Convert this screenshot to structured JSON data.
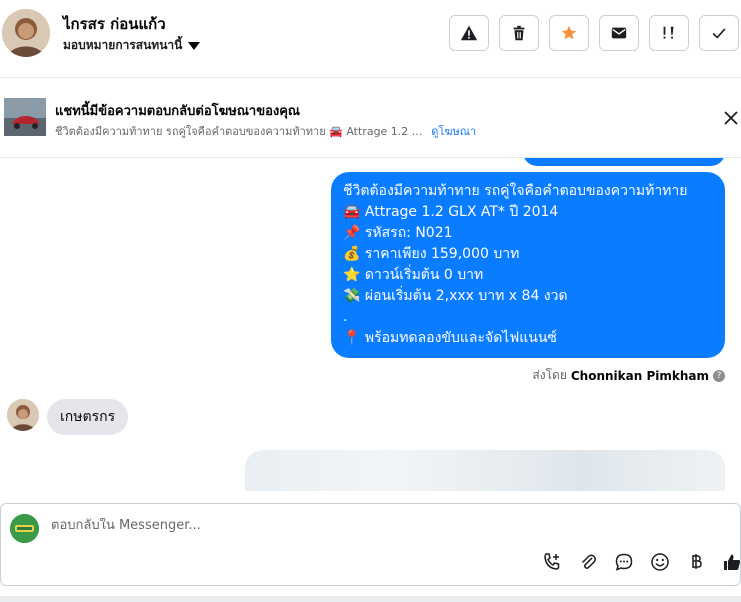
{
  "header": {
    "contact_name": "ไกรสร ก่อนแก้ว",
    "assign_label": "มอบหมายการสนทนานี้"
  },
  "ad_banner": {
    "title": "แชทนี้มีข้อความตอบกลับต่อโฆษณาของคุณ",
    "subtitle": "ชีวิตต้องมีความท้าทาย รถคู่ใจคือคำตอบของความท้าทาย 🚘 Attrage 1.2 ...",
    "view_ad_link": "ดูโฆษณา"
  },
  "messages": {
    "outgoing_lines": [
      "ชีวิตต้องมีความท้าทาย รถคู่ใจคือคำตอบของความท้าทาย",
      "🚘 Attrage 1.2 GLX AT* ปี 2014",
      "📌 รหัสรถ: N021",
      "💰 ราคาเพียง 159,000 บาท",
      "⭐ ดาวน์เริ่มต้น 0 บาท",
      "💸 ผ่อนเริ่มต้น 2,xxx บาท x 84 งวด",
      ".",
      "📍 พร้อมทดลองขับและจัดไฟแนนซ์"
    ],
    "sent_by_prefix": "ส่งโดย",
    "sent_by_name": "Chonnikan Pimkham",
    "incoming_text": "เกษตรกร"
  },
  "composer": {
    "placeholder": "ตอบกลับใน Messenger..."
  },
  "icons": {
    "actions": [
      "warning-icon",
      "trash-icon",
      "star-icon",
      "envelope-icon",
      "priority-icon",
      "check-icon"
    ],
    "tools": [
      "phone-plus-icon",
      "paperclip-icon",
      "saved-reply-icon",
      "emoji-icon",
      "baht-icon",
      "thumbs-up-icon"
    ]
  },
  "colors": {
    "accent": "#0a7cff",
    "star": "#f7923a",
    "incoming_bubble": "#e4e6eb"
  }
}
